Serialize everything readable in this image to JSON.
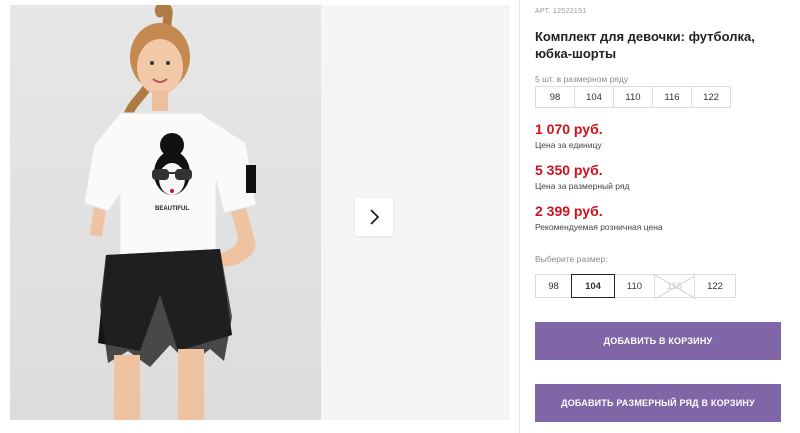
{
  "colors": {
    "accent_red": "#d0111b",
    "button_purple": "#8066a6",
    "text_dark": "#222222",
    "muted": "#8a8a8a"
  },
  "gallery": {
    "next_icon": "chevron-right-icon",
    "print_text": "BEAUTIFUL"
  },
  "product": {
    "article": "АРТ. 12522151",
    "title": "Комплект для девочки: футболка, юбка-шорты"
  },
  "pack": {
    "caption": "5 шт. в размерном ряду",
    "sizes": [
      "98",
      "104",
      "110",
      "116",
      "122"
    ]
  },
  "prices": [
    {
      "value": "1 070 руб.",
      "note": "Цена за единицу"
    },
    {
      "value": "5 350 руб.",
      "note": "Цена за размерный ряд"
    },
    {
      "value": "2 399 руб.",
      "note": "Рекомендуемая розничная цена"
    }
  ],
  "size_select": {
    "caption": "Выберите размер:",
    "sizes": [
      {
        "label": "98",
        "state": "available"
      },
      {
        "label": "104",
        "state": "selected"
      },
      {
        "label": "110",
        "state": "available"
      },
      {
        "label": "116",
        "state": "unavailable"
      },
      {
        "label": "122",
        "state": "available"
      }
    ]
  },
  "buttons": {
    "add_to_cart": "ДОБАВИТЬ В КОРЗИНУ",
    "add_pack_to_cart": "ДОБАВИТЬ РАЗМЕРНЫЙ РЯД В КОРЗИНУ"
  }
}
